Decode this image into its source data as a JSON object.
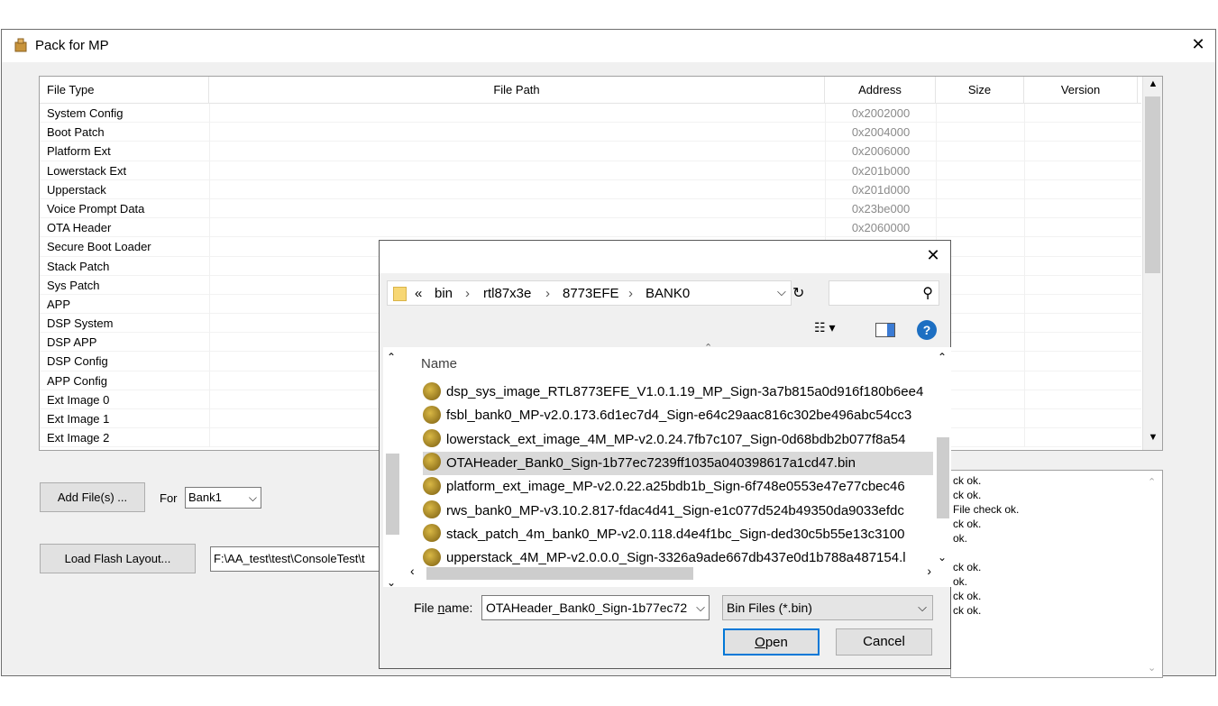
{
  "window": {
    "title": "Pack for MP",
    "close": "✕"
  },
  "grid": {
    "columns": [
      "File Type",
      "File Path",
      "Address",
      "Size",
      "Version"
    ],
    "rows": [
      {
        "type": "System Config",
        "addr": "0x2002000"
      },
      {
        "type": "Boot Patch",
        "addr": "0x2004000"
      },
      {
        "type": "Platform Ext",
        "addr": "0x2006000"
      },
      {
        "type": "Lowerstack Ext",
        "addr": "0x201b000"
      },
      {
        "type": "Upperstack",
        "addr": "0x201d000"
      },
      {
        "type": "Voice Prompt Data",
        "addr": "0x23be000"
      },
      {
        "type": "OTA Header",
        "addr": "0x2060000"
      },
      {
        "type": "Secure Boot Loader",
        "addr": ""
      },
      {
        "type": "Stack Patch",
        "addr": ""
      },
      {
        "type": "Sys Patch",
        "addr": ""
      },
      {
        "type": "APP",
        "addr": ""
      },
      {
        "type": "DSP System",
        "addr": ""
      },
      {
        "type": "DSP APP",
        "addr": ""
      },
      {
        "type": "DSP Config",
        "addr": ""
      },
      {
        "type": "APP Config",
        "addr": ""
      },
      {
        "type": "Ext Image 0",
        "addr": ""
      },
      {
        "type": "Ext Image 1",
        "addr": ""
      },
      {
        "type": "Ext Image 2",
        "addr": ""
      }
    ]
  },
  "controls": {
    "add_files": "Add File(s) ...",
    "for_label": "For",
    "bank_value": "Bank1",
    "load_flash": "Load Flash Layout...",
    "flash_path": "F:\\AA_test\\test\\ConsoleTest\\t"
  },
  "log": [
    "ck ok.",
    "ck ok.",
    " File check ok.",
    "ck ok.",
    "ok.",
    "",
    "ck ok.",
    "ok.",
    "ck ok.",
    "ck ok."
  ],
  "dialog": {
    "breadcrumb": [
      "«",
      "bin",
      "›",
      "rtl87x3e",
      "›",
      "8773EFE",
      "›",
      "BANK0"
    ],
    "column_name": "Name",
    "files": [
      "dsp_sys_image_RTL8773EFE_V1.0.1.19_MP_Sign-3a7b815a0d916f180b6ee4",
      "fsbl_bank0_MP-v2.0.173.6d1ec7d4_Sign-e64c29aac816c302be496abc54cc3",
      "lowerstack_ext_image_4M_MP-v2.0.24.7fb7c107_Sign-0d68bdb2b077f8a54",
      "OTAHeader_Bank0_Sign-1b77ec7239ff1035a040398617a1cd47.bin",
      "platform_ext_image_MP-v2.0.22.a25bdb1b_Sign-6f748e0553e47e77cbec46",
      "rws_bank0_MP-v3.10.2.817-fdac4d41_Sign-e1c077d524b49350da9033efdc",
      "stack_patch_4m_bank0_MP-v2.0.118.d4e4f1bc_Sign-ded30c5b55e13c3100",
      "upperstack_4M_MP-v2.0.0.0_Sign-3326a9ade667db437e0d1b788a487154.l"
    ],
    "selected_index": 3,
    "filename_label": "File name:",
    "filename_value": "OTAHeader_Bank0_Sign-1b77ec72",
    "filetype_value": "Bin Files (*.bin)",
    "open": "Open",
    "cancel": "Cancel"
  }
}
